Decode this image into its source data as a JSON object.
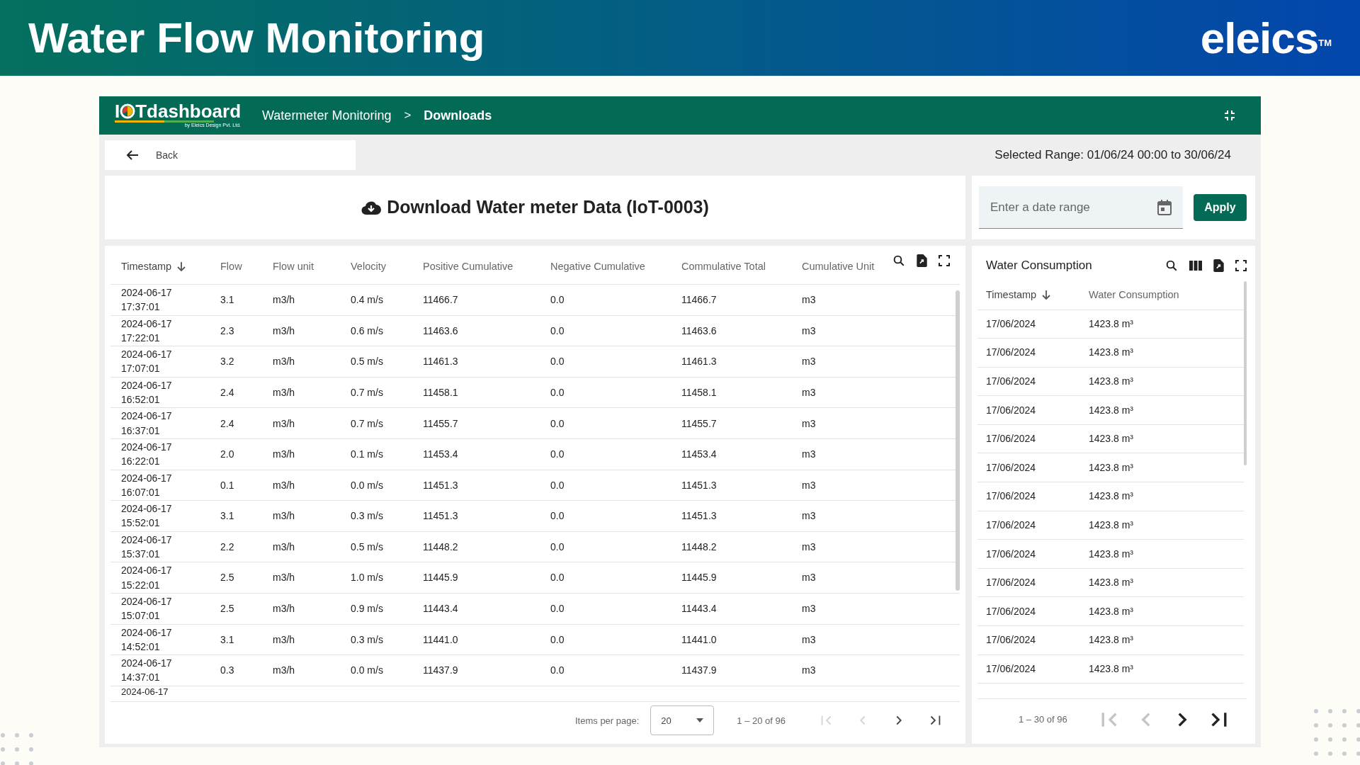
{
  "banner": {
    "title": "Water Flow Monitoring",
    "brand": "eleics",
    "trademark": "TM"
  },
  "navbar": {
    "logo_start": "I",
    "logo_end": "Tdashboard",
    "logo_tagline": "by Eleics Design Pvt. Ltd.",
    "breadcrumb": [
      {
        "label": "Watermeter Monitoring",
        "current": false
      },
      {
        "label": "Downloads",
        "current": true
      }
    ],
    "separator": ">"
  },
  "back": {
    "label": "Back"
  },
  "selected_range": "Selected Range: 01/06/24 00:00 to 30/06/24",
  "download_title": "Download Water meter Data (IoT-0003)",
  "date_field": {
    "placeholder": "Enter a date range"
  },
  "apply_button": "Apply",
  "flow_table": {
    "columns": [
      {
        "label": "Timestamp",
        "sorted": true
      },
      {
        "label": "Flow",
        "sorted": false
      },
      {
        "label": "Flow unit",
        "sorted": false
      },
      {
        "label": "Velocity",
        "sorted": false
      },
      {
        "label": "Positive Cumulative",
        "sorted": false
      },
      {
        "label": "Negative Cumulative",
        "sorted": false
      },
      {
        "label": "Commulative Total",
        "sorted": false
      },
      {
        "label": "Cumulative Unit",
        "sorted": false
      }
    ],
    "rows": [
      {
        "date": "2024-06-17",
        "time": "17:37:01",
        "cells": [
          "3.1",
          "m3/h",
          "0.4 m/s",
          "11466.7",
          "0.0",
          "11466.7",
          "m3"
        ]
      },
      {
        "date": "2024-06-17",
        "time": "17:22:01",
        "cells": [
          "2.3",
          "m3/h",
          "0.6 m/s",
          "11463.6",
          "0.0",
          "11463.6",
          "m3"
        ]
      },
      {
        "date": "2024-06-17",
        "time": "17:07:01",
        "cells": [
          "3.2",
          "m3/h",
          "0.5 m/s",
          "11461.3",
          "0.0",
          "11461.3",
          "m3"
        ]
      },
      {
        "date": "2024-06-17",
        "time": "16:52:01",
        "cells": [
          "2.4",
          "m3/h",
          "0.7 m/s",
          "11458.1",
          "0.0",
          "11458.1",
          "m3"
        ]
      },
      {
        "date": "2024-06-17",
        "time": "16:37:01",
        "cells": [
          "2.4",
          "m3/h",
          "0.7 m/s",
          "11455.7",
          "0.0",
          "11455.7",
          "m3"
        ]
      },
      {
        "date": "2024-06-17",
        "time": "16:22:01",
        "cells": [
          "2.0",
          "m3/h",
          "0.1 m/s",
          "11453.4",
          "0.0",
          "11453.4",
          "m3"
        ]
      },
      {
        "date": "2024-06-17",
        "time": "16:07:01",
        "cells": [
          "0.1",
          "m3/h",
          "0.0 m/s",
          "11451.3",
          "0.0",
          "11451.3",
          "m3"
        ]
      },
      {
        "date": "2024-06-17",
        "time": "15:52:01",
        "cells": [
          "3.1",
          "m3/h",
          "0.3 m/s",
          "11451.3",
          "0.0",
          "11451.3",
          "m3"
        ]
      },
      {
        "date": "2024-06-17",
        "time": "15:37:01",
        "cells": [
          "2.2",
          "m3/h",
          "0.5 m/s",
          "11448.2",
          "0.0",
          "11448.2",
          "m3"
        ]
      },
      {
        "date": "2024-06-17",
        "time": "15:22:01",
        "cells": [
          "2.5",
          "m3/h",
          "1.0 m/s",
          "11445.9",
          "0.0",
          "11445.9",
          "m3"
        ]
      },
      {
        "date": "2024-06-17",
        "time": "15:07:01",
        "cells": [
          "2.5",
          "m3/h",
          "0.9 m/s",
          "11443.4",
          "0.0",
          "11443.4",
          "m3"
        ]
      },
      {
        "date": "2024-06-17",
        "time": "14:52:01",
        "cells": [
          "3.1",
          "m3/h",
          "0.3 m/s",
          "11441.0",
          "0.0",
          "11441.0",
          "m3"
        ]
      },
      {
        "date": "2024-06-17",
        "time": "14:37:01",
        "cells": [
          "0.3",
          "m3/h",
          "0.0 m/s",
          "11437.9",
          "0.0",
          "11437.9",
          "m3"
        ]
      },
      {
        "date": "2024-06-17"
      }
    ],
    "pagination": {
      "items_label": "Items per page:",
      "page_size": "20",
      "range": "1 – 20 of 96",
      "buttons": [
        {
          "kind": "first",
          "disabled": true
        },
        {
          "kind": "prev",
          "disabled": true
        },
        {
          "kind": "next",
          "disabled": false
        },
        {
          "kind": "last",
          "disabled": false
        }
      ]
    }
  },
  "consumption_table": {
    "title": "Water Consumption",
    "columns": [
      {
        "label": "Timestamp",
        "sorted": true
      },
      {
        "label": "Water Consumption",
        "sorted": false
      }
    ],
    "rows": [
      [
        "17/06/2024",
        "1423.8 m³"
      ],
      [
        "17/06/2024",
        "1423.8 m³"
      ],
      [
        "17/06/2024",
        "1423.8 m³"
      ],
      [
        "17/06/2024",
        "1423.8 m³"
      ],
      [
        "17/06/2024",
        "1423.8 m³"
      ],
      [
        "17/06/2024",
        "1423.8 m³"
      ],
      [
        "17/06/2024",
        "1423.8 m³"
      ],
      [
        "17/06/2024",
        "1423.8 m³"
      ],
      [
        "17/06/2024",
        "1423.8 m³"
      ],
      [
        "17/06/2024",
        "1423.8 m³"
      ],
      [
        "17/06/2024",
        "1423.8 m³"
      ],
      [
        "17/06/2024",
        "1423.8 m³"
      ],
      [
        "17/06/2024",
        "1423.8 m³"
      ]
    ],
    "pagination": {
      "range": "1 – 30 of 96",
      "buttons": [
        {
          "kind": "first",
          "disabled": true
        },
        {
          "kind": "prev",
          "disabled": true
        },
        {
          "kind": "next",
          "disabled": false
        },
        {
          "kind": "last",
          "disabled": false
        }
      ]
    }
  }
}
